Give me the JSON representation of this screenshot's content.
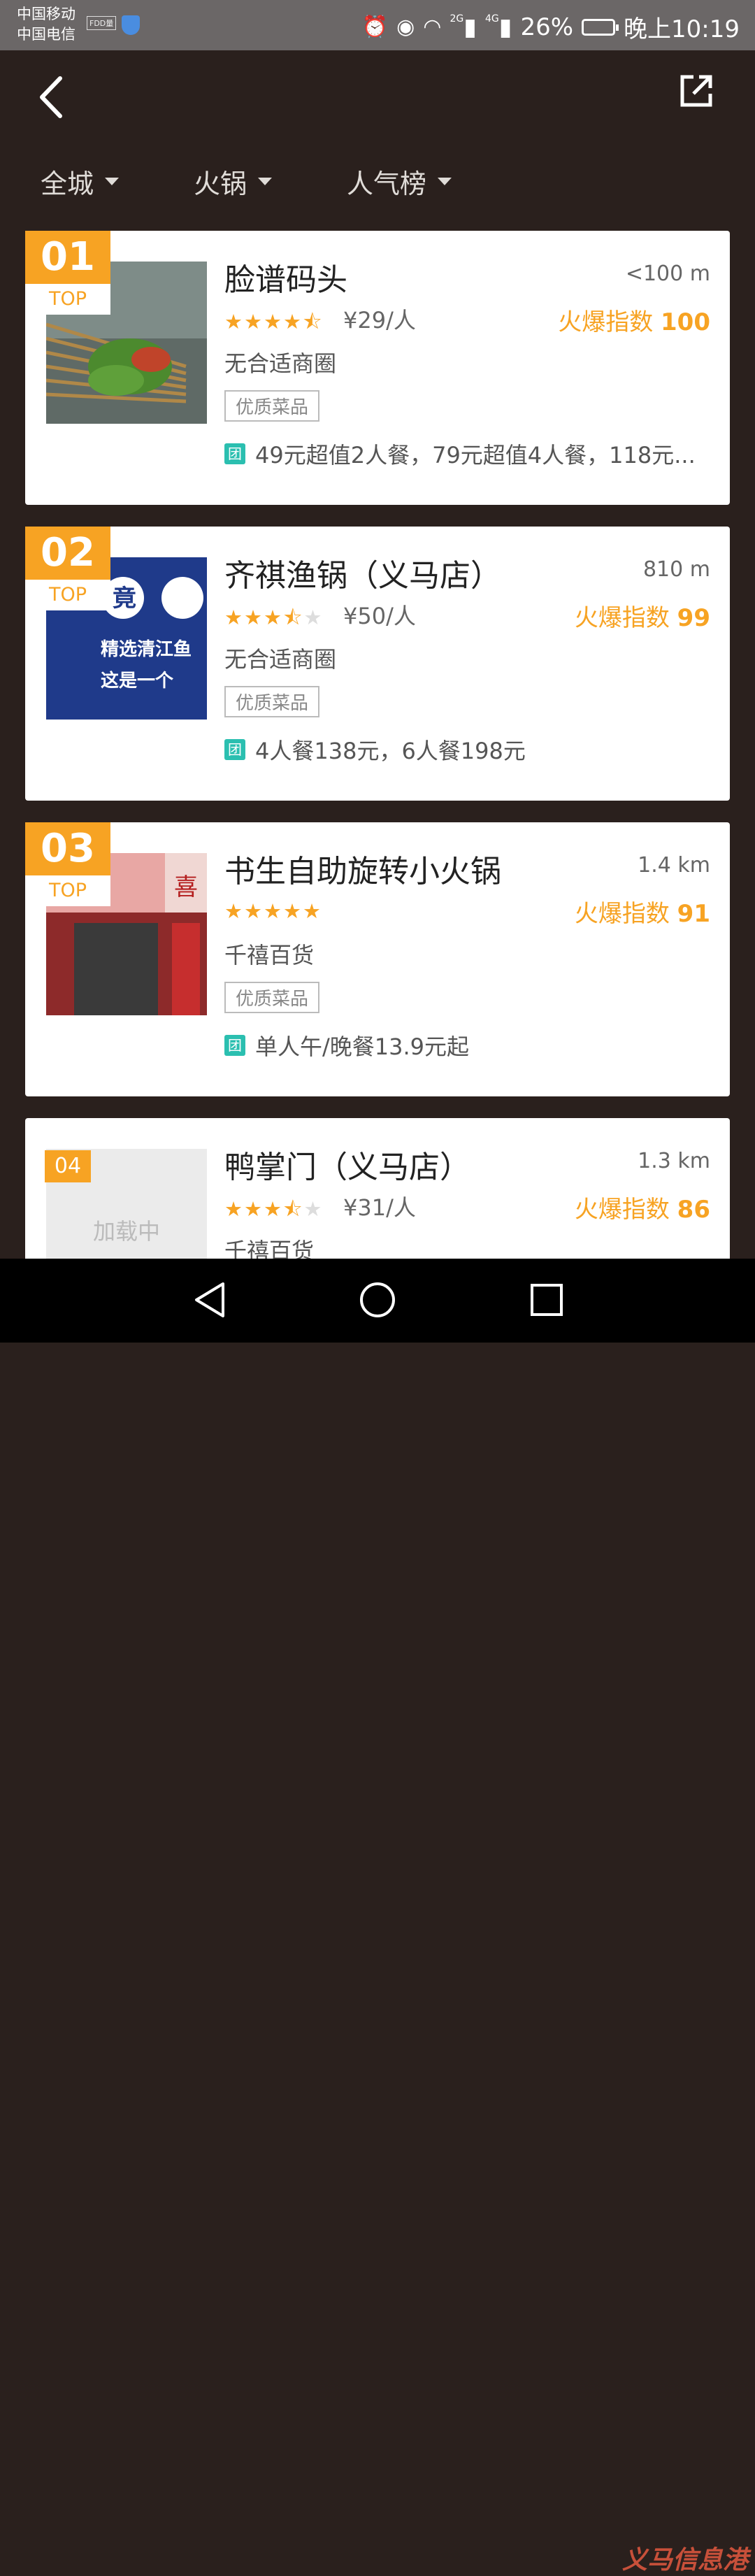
{
  "status_bar": {
    "carrier_1": "中国移动",
    "carrier_2": "中国电信",
    "carrier_badge": "FDD量",
    "signal_1": "2G",
    "signal_2": "4G",
    "battery": "26%",
    "time": "晚上10:19"
  },
  "header": {
    "back_icon": "chevron-left-icon",
    "share_icon": "share-external-icon"
  },
  "filters": [
    {
      "label": "全城"
    },
    {
      "label": "火锅"
    },
    {
      "label": "人气榜"
    }
  ],
  "restaurants": [
    {
      "rank": "01",
      "rank_tag": "TOP",
      "name": "脸谱码头",
      "distance": "<100 m",
      "rating": 4.5,
      "price": "¥29/人",
      "hot_label": "火爆指数",
      "hot_value": "100",
      "area": "无合适商圈",
      "tag": "优质菜品",
      "deal_icon": "团",
      "deal": "49元超值2人餐，79元超值4人餐，118元..."
    },
    {
      "rank": "02",
      "rank_tag": "TOP",
      "name": "齐祺渔锅（义马店）",
      "distance": "810 m",
      "rating": 3.5,
      "price": "¥50/人",
      "hot_label": "火爆指数",
      "hot_value": "99",
      "area": "无合适商圈",
      "tag": "优质菜品",
      "deal_icon": "团",
      "deal": "4人餐138元，6人餐198元",
      "image_text_1": "精选清江鱼",
      "image_text_2": "这是一个",
      "image_text_3": "竟"
    },
    {
      "rank": "03",
      "rank_tag": "TOP",
      "name": "书生自助旋转小火锅",
      "distance": "1.4 km",
      "rating": 5,
      "price": "",
      "hot_label": "火爆指数",
      "hot_value": "91",
      "area": "千禧百货",
      "tag": "优质菜品",
      "deal_icon": "团",
      "deal": "单人午/晚餐13.9元起",
      "image_text_1": "喜"
    },
    {
      "rank": "04",
      "rank_tag": "",
      "name": "鸭掌门（义马店）",
      "distance": "1.3 km",
      "rating": 3.5,
      "price": "¥31/人",
      "hot_label": "火爆指数",
      "hot_value": "86",
      "area": "千禧百货",
      "loading_text": "加载中"
    }
  ],
  "nav": {
    "back": "triangle-back-icon",
    "home": "circle-home-icon",
    "recents": "square-recents-icon"
  },
  "watermark": "义马信息港"
}
